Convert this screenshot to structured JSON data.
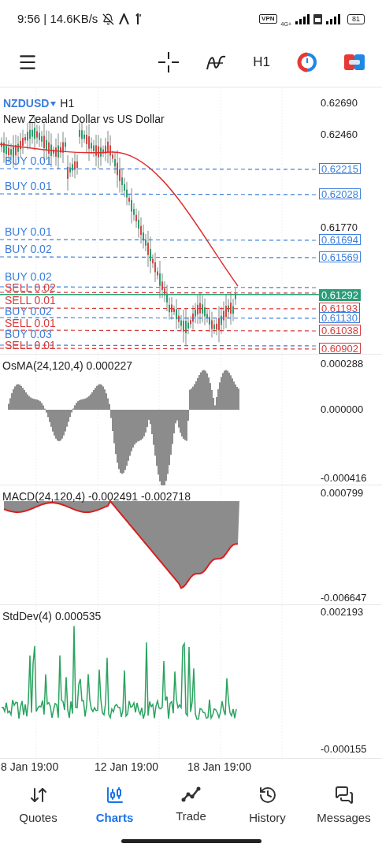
{
  "status_bar": {
    "time": "9:56 | 14.6KB/s",
    "vpn": "VPN",
    "network": "4G+",
    "battery": "81"
  },
  "toolbar": {
    "timeframe": "H1"
  },
  "chart": {
    "symbol": "NZDUSD",
    "timeframe": "H1",
    "description": "New Zealand Dollar vs US Dollar",
    "price_ticks": [
      "0.62690",
      "0.62460",
      "0.61770"
    ],
    "current_price": "0.61292",
    "orders": [
      {
        "kind": "buy",
        "label": "BUY 0.01",
        "price": "0.62215"
      },
      {
        "kind": "buy",
        "label": "BUY 0.01",
        "price": "0.62028"
      },
      {
        "kind": "buy",
        "label": "BUY 0.01",
        "price": "0.61694"
      },
      {
        "kind": "buy",
        "label": "BUY 0.02",
        "price": "0.61569"
      },
      {
        "kind": "buy",
        "label": "BUY 0.02"
      },
      {
        "kind": "sell",
        "label": "SELL 0.02"
      },
      {
        "kind": "sell",
        "label": "SELL 0.01",
        "price": "0.61193"
      },
      {
        "kind": "buy",
        "label": "BUY 0.02",
        "price": "0.61130"
      },
      {
        "kind": "sell",
        "label": "SELL 0.01",
        "price": "0.61038"
      },
      {
        "kind": "buy",
        "label": "BUY 0.03"
      },
      {
        "kind": "sell",
        "label": "SELL 0.01",
        "price": "0.60902"
      }
    ]
  },
  "indicators": [
    {
      "kind": "osma",
      "title": "OsMA(24,120,4) 0.000227",
      "ticks": [
        "0.000288",
        "0.000000",
        "-0.000416"
      ]
    },
    {
      "kind": "macd",
      "title": "MACD(24,120,4) -0.002491 -0.002718",
      "ticks": [
        "0.000799",
        "-0.006647"
      ]
    },
    {
      "kind": "stddev",
      "title": "StdDev(4) 0.000535",
      "ticks": [
        "0.002193",
        "-0.000155"
      ]
    }
  ],
  "time_axis": [
    "8 Jan 19:00",
    "12 Jan 19:00",
    "18 Jan 19:00"
  ],
  "nav": [
    {
      "kind": "quotes",
      "label": "Quotes",
      "selected": false
    },
    {
      "kind": "charts",
      "label": "Charts",
      "selected": true
    },
    {
      "kind": "trade",
      "label": "Trade",
      "selected": false
    },
    {
      "kind": "history",
      "label": "History",
      "selected": false
    },
    {
      "kind": "messages",
      "label": "Messages",
      "selected": false
    }
  ]
}
